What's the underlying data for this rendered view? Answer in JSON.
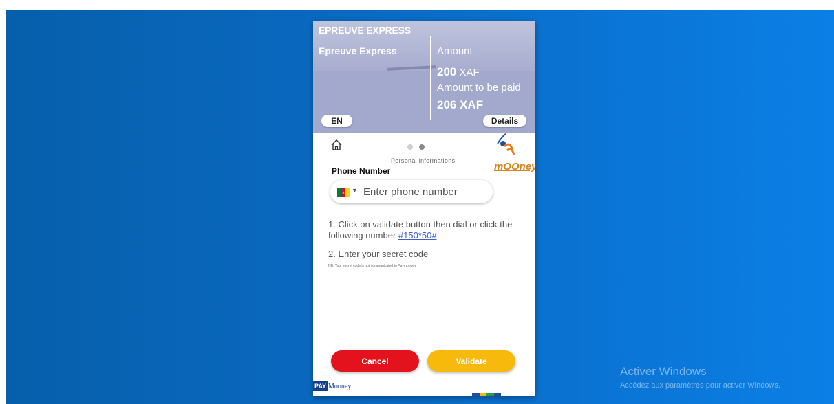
{
  "header": {
    "merchant_title": "EPREUVE EXPRESS",
    "merchant_name": "Epreuve Express",
    "amount_label": "Amount",
    "amount_value": "200",
    "amount_currency": "XAF",
    "to_pay_label": "Amount to be paid",
    "to_pay_value": "206 XAF",
    "language": "EN",
    "details_label": "Details"
  },
  "steps": {
    "label": "Personal informations",
    "total": 2,
    "current": 2
  },
  "brand": {
    "logo_text": "mOOney"
  },
  "form": {
    "phone_label": "Phone Number",
    "phone_placeholder": "Enter phone number",
    "phone_value": "",
    "country_flag": "cameroon-flag"
  },
  "instructions": {
    "step1_text": "1. Click on validate button then dial or click the following number ",
    "step1_code": "#150*50#",
    "step2_text": "2. Enter your secret code",
    "note": "NB: Your secret code is not communicated to Paymooney"
  },
  "buttons": {
    "cancel": "Cancel",
    "validate": "Validate"
  },
  "footer": {
    "badge": "PAY",
    "brand": "Mooney"
  },
  "watermark": {
    "title": "Activer Windows",
    "subtitle": "Accédez aux paramètres pour activer Windows."
  },
  "colors": {
    "header_bg": "#a3a9cd",
    "cancel": "#e3121c",
    "validate": "#f8b90d",
    "link": "#3d5fc8",
    "brand_orange": "#d8821c",
    "paymooney_blue": "#143f8c"
  }
}
